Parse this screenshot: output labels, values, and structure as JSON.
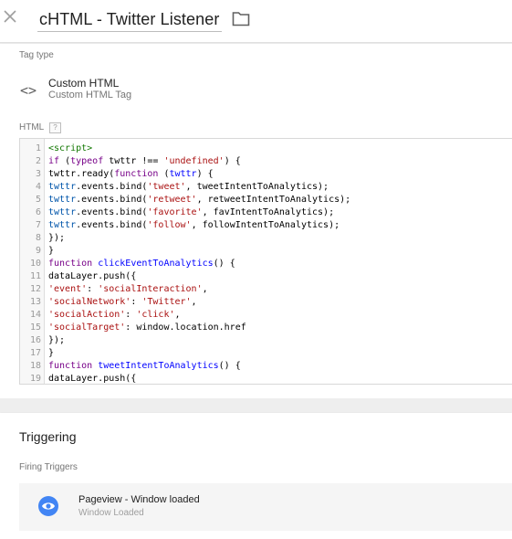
{
  "header": {
    "title": "cHTML - Twitter Listener",
    "close_icon": "close-icon",
    "folder_icon": "folder-icon"
  },
  "tag_config": {
    "tag_type_label": "Tag type",
    "tag_name": "Custom HTML",
    "tag_sub": "Custom HTML Tag",
    "tag_icon": "code-brackets-icon",
    "tag_icon_glyph": "<>",
    "html_label": "HTML",
    "help_label": "?"
  },
  "code_lines": [
    {
      "n": "1",
      "segs": [
        {
          "t": "<script>",
          "c": "tag"
        }
      ]
    },
    {
      "n": "2",
      "segs": [
        {
          "t": "if",
          "c": "kw"
        },
        {
          "t": " (",
          "c": ""
        },
        {
          "t": "typeof",
          "c": "kw"
        },
        {
          "t": " twttr !== ",
          "c": ""
        },
        {
          "t": "'undefined'",
          "c": "str"
        },
        {
          "t": ") {",
          "c": ""
        }
      ]
    },
    {
      "n": "3",
      "segs": [
        {
          "t": "twttr.ready(",
          "c": ""
        },
        {
          "t": "function",
          "c": "kw"
        },
        {
          "t": " (",
          "c": ""
        },
        {
          "t": "twttr",
          "c": "fn"
        },
        {
          "t": ") {",
          "c": ""
        }
      ]
    },
    {
      "n": "4",
      "segs": [
        {
          "t": "twttr",
          "c": "prop"
        },
        {
          "t": ".events.bind(",
          "c": ""
        },
        {
          "t": "'tweet'",
          "c": "str"
        },
        {
          "t": ", tweetIntentToAnalytics);",
          "c": ""
        }
      ]
    },
    {
      "n": "5",
      "segs": [
        {
          "t": "twttr",
          "c": "prop"
        },
        {
          "t": ".events.bind(",
          "c": ""
        },
        {
          "t": "'retweet'",
          "c": "str"
        },
        {
          "t": ", retweetIntentToAnalytics);",
          "c": ""
        }
      ]
    },
    {
      "n": "6",
      "segs": [
        {
          "t": "twttr",
          "c": "prop"
        },
        {
          "t": ".events.bind(",
          "c": ""
        },
        {
          "t": "'favorite'",
          "c": "str"
        },
        {
          "t": ", favIntentToAnalytics);",
          "c": ""
        }
      ]
    },
    {
      "n": "7",
      "segs": [
        {
          "t": "twttr",
          "c": "prop"
        },
        {
          "t": ".events.bind(",
          "c": ""
        },
        {
          "t": "'follow'",
          "c": "str"
        },
        {
          "t": ", followIntentToAnalytics);",
          "c": ""
        }
      ]
    },
    {
      "n": "8",
      "segs": [
        {
          "t": "});",
          "c": ""
        }
      ]
    },
    {
      "n": "9",
      "segs": [
        {
          "t": "}",
          "c": ""
        }
      ]
    },
    {
      "n": "10",
      "segs": [
        {
          "t": "function",
          "c": "kw"
        },
        {
          "t": " ",
          "c": ""
        },
        {
          "t": "clickEventToAnalytics",
          "c": "fn"
        },
        {
          "t": "() {",
          "c": ""
        }
      ]
    },
    {
      "n": "11",
      "segs": [
        {
          "t": "dataLayer.push({",
          "c": ""
        }
      ]
    },
    {
      "n": "12",
      "segs": [
        {
          "t": "'event'",
          "c": "str"
        },
        {
          "t": ": ",
          "c": ""
        },
        {
          "t": "'socialInteraction'",
          "c": "str"
        },
        {
          "t": ",",
          "c": ""
        }
      ]
    },
    {
      "n": "13",
      "segs": [
        {
          "t": "'socialNetwork'",
          "c": "str"
        },
        {
          "t": ": ",
          "c": ""
        },
        {
          "t": "'Twitter'",
          "c": "str"
        },
        {
          "t": ",",
          "c": ""
        }
      ]
    },
    {
      "n": "14",
      "segs": [
        {
          "t": "'socialAction'",
          "c": "str"
        },
        {
          "t": ": ",
          "c": ""
        },
        {
          "t": "'click'",
          "c": "str"
        },
        {
          "t": ",",
          "c": ""
        }
      ]
    },
    {
      "n": "15",
      "segs": [
        {
          "t": "'socialTarget'",
          "c": "str"
        },
        {
          "t": ": window.location.href",
          "c": ""
        }
      ]
    },
    {
      "n": "16",
      "segs": [
        {
          "t": "});",
          "c": ""
        }
      ]
    },
    {
      "n": "17",
      "segs": [
        {
          "t": "}",
          "c": ""
        }
      ]
    },
    {
      "n": "18",
      "segs": [
        {
          "t": "function",
          "c": "kw"
        },
        {
          "t": " ",
          "c": ""
        },
        {
          "t": "tweetIntentToAnalytics",
          "c": "fn"
        },
        {
          "t": "() {",
          "c": ""
        }
      ]
    },
    {
      "n": "19",
      "segs": [
        {
          "t": "dataLayer.push({",
          "c": ""
        }
      ]
    }
  ],
  "triggering": {
    "title": "Triggering",
    "firing_label": "Firing Triggers",
    "trigger_name": "Pageview - Window loaded",
    "trigger_sub": "Window Loaded",
    "trigger_icon": "eye-icon",
    "trigger_icon_color": "#4285f4"
  }
}
